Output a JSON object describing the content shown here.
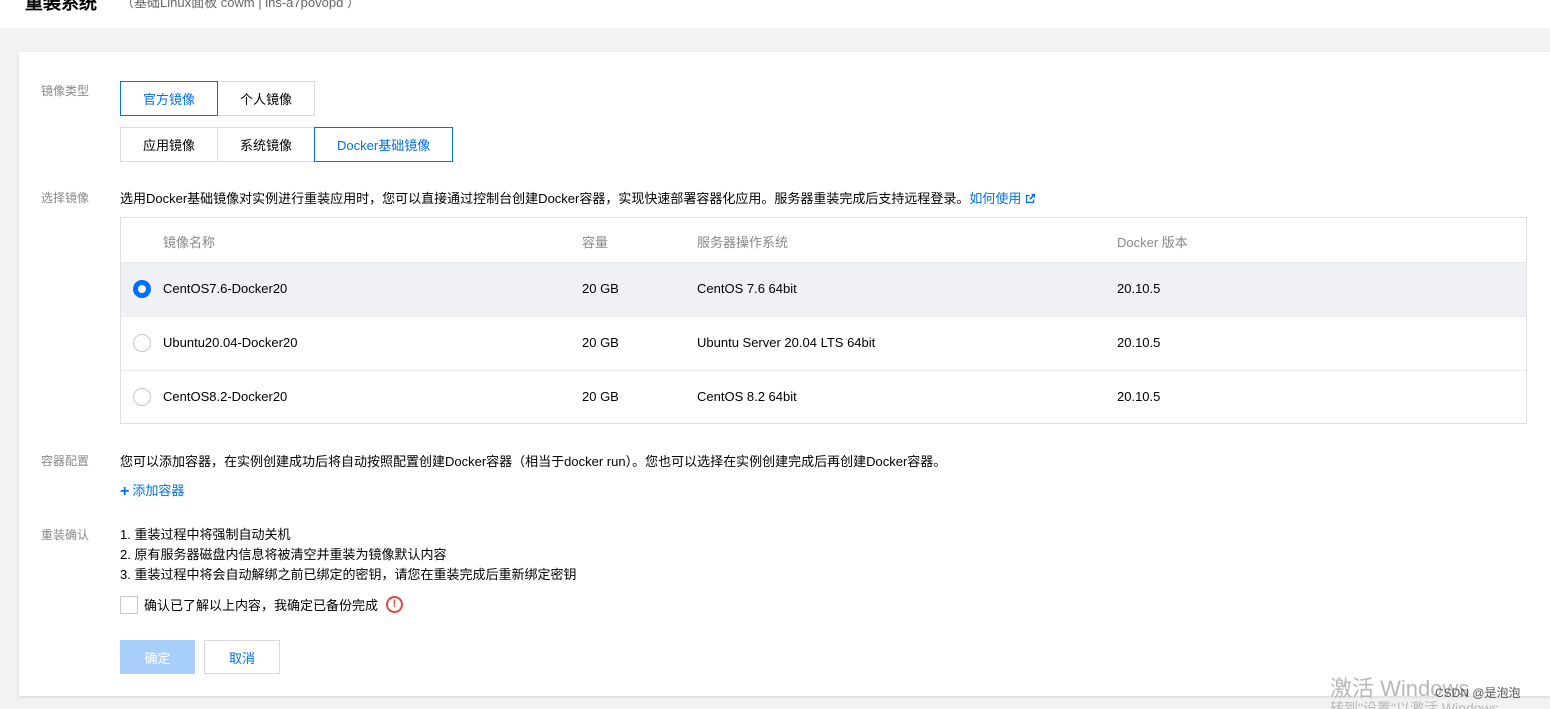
{
  "header": {
    "title": "重装系统",
    "subtitle": "（基础Linux面板 cowm | ins-a7povopd ）"
  },
  "image_type": {
    "label": "镜像类型",
    "source_tabs": [
      {
        "label": "官方镜像",
        "active": true
      },
      {
        "label": "个人镜像",
        "active": false
      }
    ],
    "category_tabs": [
      {
        "label": "应用镜像",
        "active": false
      },
      {
        "label": "系统镜像",
        "active": false
      },
      {
        "label": "Docker基础镜像",
        "active": true
      }
    ]
  },
  "select_image": {
    "label": "选择镜像",
    "description": "选用Docker基础镜像对实例进行重装应用时，您可以直接通过控制台创建Docker容器，实现快速部署容器化应用。服务器重装完成后支持远程登录。",
    "help_link": "如何使用",
    "table": {
      "headers": {
        "name": "镜像名称",
        "size": "容量",
        "os": "服务器操作系统",
        "docker": "Docker 版本"
      },
      "rows": [
        {
          "name": "CentOS7.6-Docker20",
          "size": "20 GB",
          "os": "CentOS 7.6 64bit",
          "docker": "20.10.5",
          "selected": true
        },
        {
          "name": "Ubuntu20.04-Docker20",
          "size": "20 GB",
          "os": "Ubuntu Server 20.04 LTS 64bit",
          "docker": "20.10.5",
          "selected": false
        },
        {
          "name": "CentOS8.2-Docker20",
          "size": "20 GB",
          "os": "CentOS 8.2 64bit",
          "docker": "20.10.5",
          "selected": false
        }
      ]
    }
  },
  "container_config": {
    "label": "容器配置",
    "description": "您可以添加容器，在实例创建成功后将自动按照配置创建Docker容器（相当于docker run）。您也可以选择在实例创建完成后再创建Docker容器。",
    "add_link": "添加容器"
  },
  "reinstall_confirm": {
    "label": "重装确认",
    "notes": [
      "1. 重装过程中将强制自动关机",
      "2. 原有服务器磁盘内信息将被清空并重装为镜像默认内容",
      "3. 重装过程中将会自动解绑之前已绑定的密钥，请您在重装完成后重新绑定密钥"
    ],
    "checkbox_label": "确认已了解以上内容，我确定已备份完成"
  },
  "buttons": {
    "ok": "确定",
    "cancel": "取消"
  },
  "watermarks": {
    "windows_activate": "激活 Windows",
    "windows_hint": "转到\"设置\"以激活 Windows。",
    "csdn": "CSDN @是泡泡"
  },
  "colors": {
    "accent": "#006eff",
    "warning": "#e54545",
    "disabled_button": "#a8cff9"
  }
}
